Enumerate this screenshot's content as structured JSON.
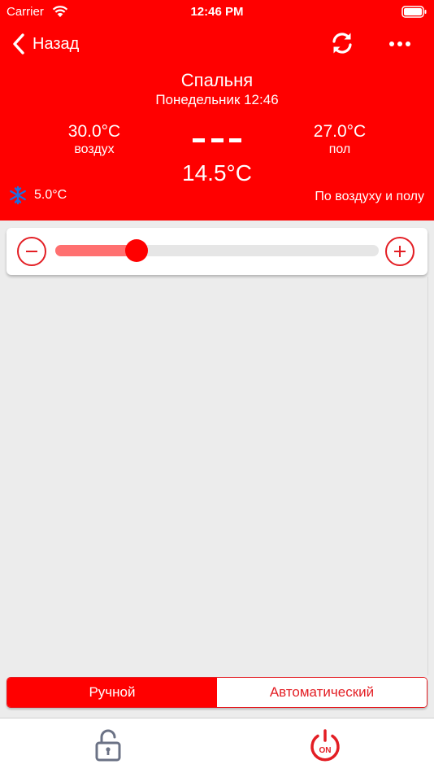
{
  "status_bar": {
    "carrier": "Carrier",
    "time": "12:46 PM"
  },
  "nav": {
    "back_label": "Назад"
  },
  "room": {
    "name": "Спальня",
    "day_time": "Понедельник 12:46"
  },
  "air": {
    "temperature": "30.0°C",
    "label": "воздух"
  },
  "floor": {
    "temperature": "27.0°C",
    "label": "пол"
  },
  "current_placeholder": "---",
  "setpoint": "14.5°C",
  "cooling": {
    "temperature": "5.0°C",
    "icon": "snowflake-icon"
  },
  "regulation_mode": "По воздуху и полу",
  "slider": {
    "fraction": 0.25
  },
  "mode_toggle": {
    "manual": "Ручной",
    "auto": "Автоматический",
    "selected": "manual"
  },
  "icons": {
    "back": "chevron-left-icon",
    "refresh": "refresh-icon",
    "more": "more-icon",
    "lock": "lock-icon",
    "power": "power-icon",
    "power_label": "ON"
  },
  "colors": {
    "accent": "#ff0000",
    "accent_dark": "#e31e24",
    "slider_fill": "#ff7070",
    "icon_gray": "#6b7285",
    "background": "#ececec"
  }
}
